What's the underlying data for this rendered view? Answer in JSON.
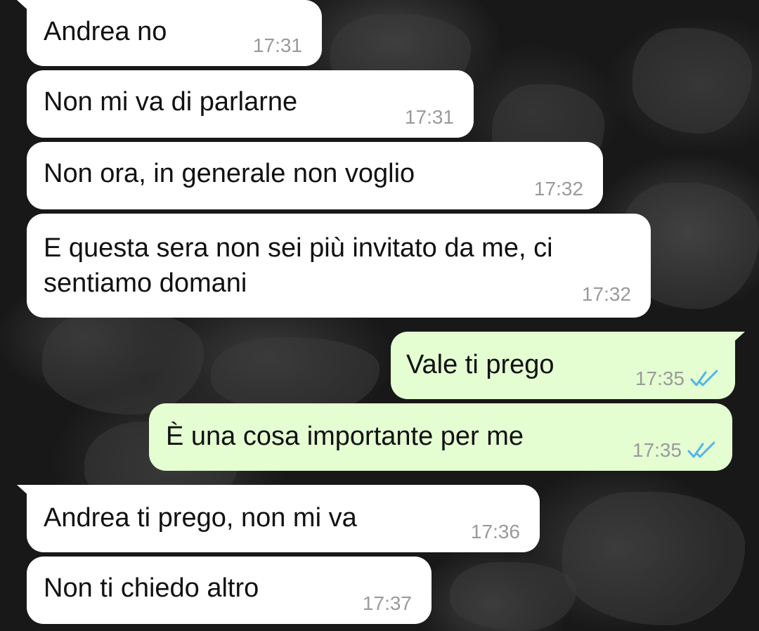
{
  "chat": {
    "messages": [
      {
        "text": "Andrea no",
        "time": "17:31",
        "direction": "incoming"
      },
      {
        "text": "Non mi va di parlarne",
        "time": "17:31",
        "direction": "incoming"
      },
      {
        "text": "Non ora, in generale non voglio",
        "time": "17:32",
        "direction": "incoming"
      },
      {
        "text": "E questa sera non sei più invitato da me, ci\nsentiamo domani",
        "time": "17:32",
        "direction": "incoming"
      },
      {
        "text": "Vale ti prego",
        "time": "17:35",
        "direction": "outgoing",
        "status": "read",
        "status_icon": "double-check-icon"
      },
      {
        "text": "È una cosa importante per me",
        "time": "17:35",
        "direction": "outgoing",
        "status": "read",
        "status_icon": "double-check-icon"
      },
      {
        "text": "Andrea ti prego, non mi va",
        "time": "17:36",
        "direction": "incoming"
      },
      {
        "text": "Non ti chiedo altro",
        "time": "17:37",
        "direction": "incoming"
      }
    ]
  },
  "colors": {
    "incoming_bubble": "#ffffff",
    "outgoing_bubble": "#e4fed2",
    "read_ticks": "#4fb6ec",
    "timestamp": "#9a9a9a",
    "background": "#181818"
  }
}
